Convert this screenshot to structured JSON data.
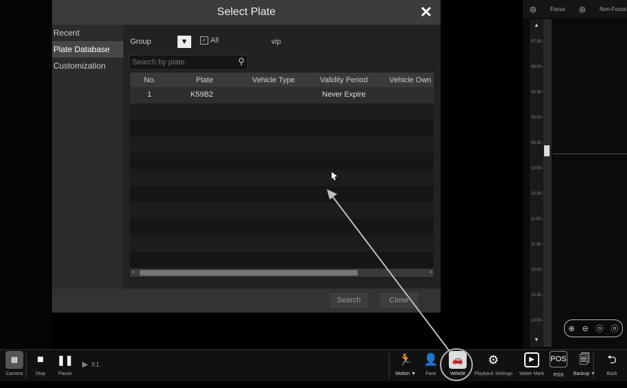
{
  "dialog": {
    "title": "Select Plate",
    "close_glyph": "✕",
    "sidebar": [
      {
        "label": "Recent",
        "active": false
      },
      {
        "label": "Plate Database",
        "active": true
      },
      {
        "label": "Customization",
        "active": false
      }
    ],
    "group_label": "Group",
    "all_label": "All",
    "vip_label": "vip",
    "search_placeholder": "Search by plate",
    "columns": [
      "No.",
      "Plate",
      "Vehicle Type",
      "Validity Period",
      "Vehicle Own"
    ],
    "rows": [
      {
        "no": "1",
        "plate": "K59B2",
        "type": "",
        "validity": "Never Expire",
        "owner": ""
      }
    ],
    "search_button": "Search",
    "close_button": "Close"
  },
  "timeline": {
    "focus_label": "Focus",
    "nonfocus_label": "Non-Focus",
    "ticks": [
      "07:30",
      "08:00",
      "08:30",
      "09:00",
      "09:30",
      "10:00",
      "10:30",
      "11:00",
      "11:30",
      "12:00",
      "12:30",
      "13:00"
    ],
    "zoom_icons": [
      "⊕",
      "⊖",
      "ⓞ",
      "ⓞ"
    ]
  },
  "bottombar": {
    "camera": "Camera",
    "stop": "Stop",
    "pause": "Pause",
    "speed": "X1",
    "motion": "Motion ▼",
    "face": "Face",
    "vehicle": "Vehicle",
    "playback_settings": "Playback Settings",
    "water_mark": "Water Mark",
    "pos": "POS",
    "pos_icon_text": "POS",
    "backup": "Backup ▼",
    "back": "Back"
  },
  "colors": {
    "highlight_ring": "#b0b0b0",
    "active_tab": "#474747"
  }
}
